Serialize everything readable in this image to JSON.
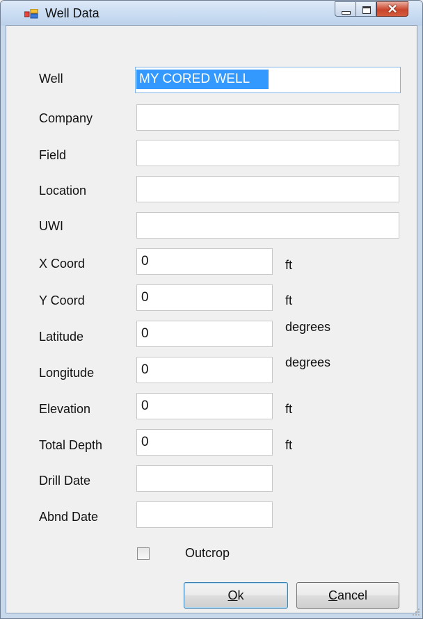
{
  "window": {
    "title": "Well Data"
  },
  "fields": {
    "well": {
      "label": "Well",
      "value": "MY CORED WELL"
    },
    "company": {
      "label": "Company",
      "value": ""
    },
    "field": {
      "label": "Field",
      "value": ""
    },
    "location": {
      "label": "Location",
      "value": ""
    },
    "uwi": {
      "label": "UWI",
      "value": ""
    },
    "x_coord": {
      "label": "X Coord",
      "value": "0",
      "unit": "ft"
    },
    "y_coord": {
      "label": "Y Coord",
      "value": "0",
      "unit": "ft"
    },
    "latitude": {
      "label": "Latitude",
      "value": "0",
      "unit": "degrees"
    },
    "longitude": {
      "label": "Longitude",
      "value": "0",
      "unit": "degrees"
    },
    "elevation": {
      "label": "Elevation",
      "value": "0",
      "unit": "ft"
    },
    "total_depth": {
      "label": "Total Depth",
      "value": "0",
      "unit": "ft"
    },
    "drill_date": {
      "label": "Drill Date",
      "value": ""
    },
    "abnd_date": {
      "label": "Abnd Date",
      "value": ""
    }
  },
  "outcrop": {
    "label": "Outcrop",
    "checked": false
  },
  "buttons": {
    "ok_label": "Ok",
    "ok_mnemonic": "O",
    "ok_rest": "k",
    "cancel_label": "Cancel",
    "cancel_mnemonic": "C",
    "cancel_rest": "ancel"
  },
  "icons": {
    "app": "window-app-icon",
    "minimize": "minimize-icon",
    "maximize": "maximize-icon",
    "close": "close-icon",
    "resize": "resize-grip-icon"
  },
  "colors": {
    "selection": "#3399ff",
    "close_button": "#c9462c",
    "title_bar": "#c9dcf2"
  }
}
